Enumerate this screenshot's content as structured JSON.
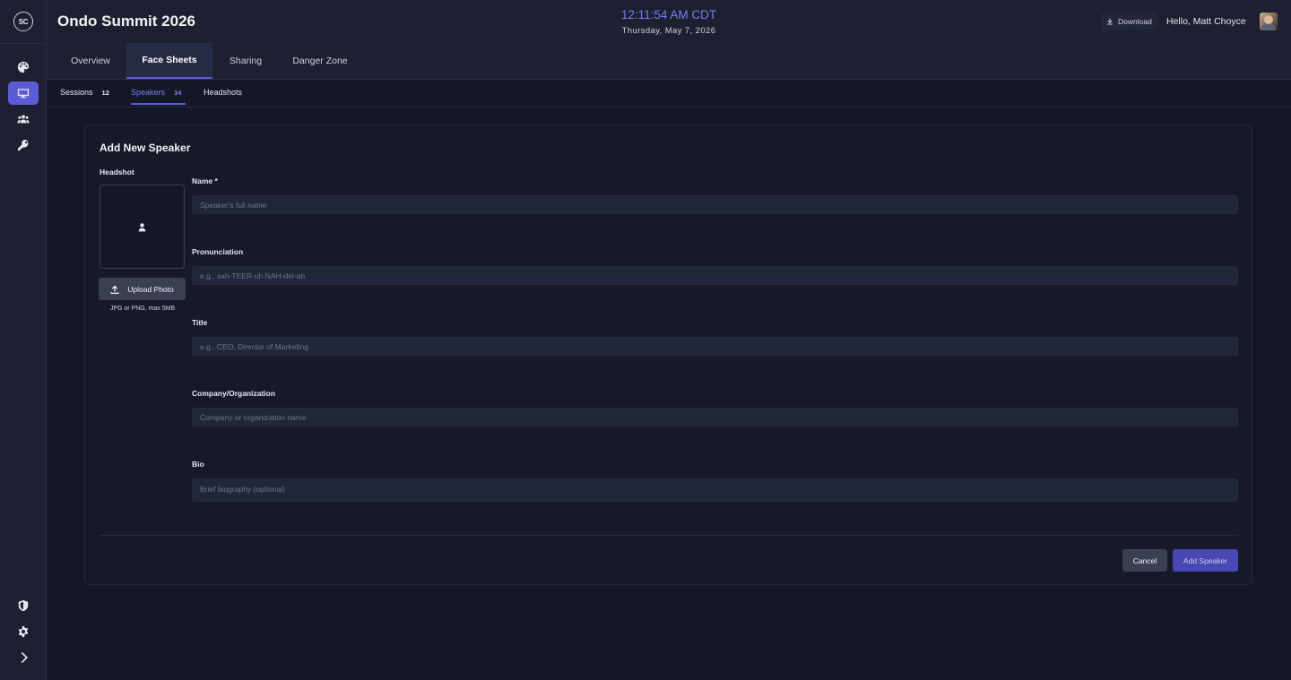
{
  "app": {
    "logo_text": "SC"
  },
  "header": {
    "event_title": "Ondo Summit 2026",
    "clock": "12:11:54 AM CDT",
    "date": "Thursday, May 7, 2026",
    "download_label": "Download",
    "greeting": "Hello, Matt Choyce"
  },
  "sidebar": {
    "items": [
      {
        "icon": "palette-icon"
      },
      {
        "icon": "monitor-icon",
        "active": true
      },
      {
        "icon": "users-icon"
      },
      {
        "icon": "key-icon"
      }
    ],
    "bottom_items": [
      {
        "icon": "shield-icon"
      },
      {
        "icon": "gear-icon"
      },
      {
        "icon": "chevron-right-icon"
      }
    ]
  },
  "tabs": [
    {
      "label": "Overview"
    },
    {
      "label": "Face Sheets",
      "active": true
    },
    {
      "label": "Sharing"
    },
    {
      "label": "Danger Zone"
    }
  ],
  "subtabs": [
    {
      "label": "Sessions",
      "count": "12"
    },
    {
      "label": "Speakers",
      "count": "34",
      "active": true
    },
    {
      "label": "Headshots"
    }
  ],
  "form": {
    "title": "Add New Speaker",
    "headshot_label": "Headshot",
    "upload_label": "Upload Photo",
    "upload_hint": "JPG or PNG, max 5MB",
    "fields": {
      "name": {
        "label": "Name *",
        "placeholder": "Speaker's full name",
        "value": ""
      },
      "pronunciation": {
        "label": "Pronunciation",
        "placeholder": "e.g., sah-TEER-uh NAH-del-ah",
        "value": ""
      },
      "title": {
        "label": "Title",
        "placeholder": "e.g., CEO, Director of Marketing",
        "value": ""
      },
      "company": {
        "label": "Company/Organization",
        "placeholder": "Company or organization name",
        "value": ""
      },
      "bio": {
        "label": "Bio",
        "placeholder": "Brief biography (optional)",
        "value": ""
      }
    },
    "cancel_label": "Cancel",
    "submit_label": "Add Speaker"
  },
  "colors": {
    "accent": "#5b5bd6",
    "clock": "#7a7cf0",
    "background": "#141826",
    "surface": "#1c2030"
  }
}
